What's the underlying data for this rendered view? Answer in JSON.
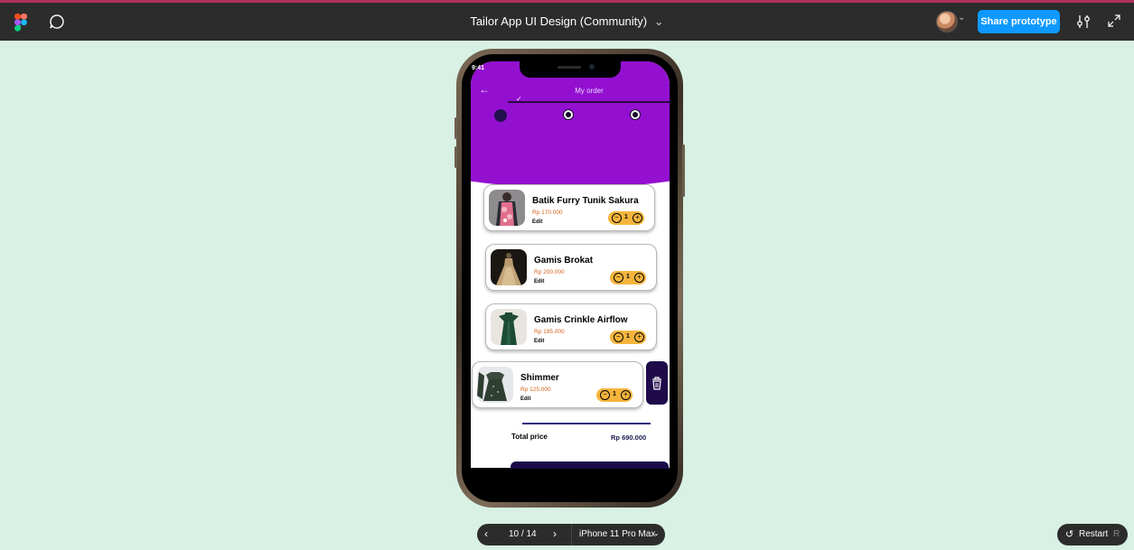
{
  "toolbar": {
    "title": "Tailor App UI Design (Community)",
    "title_caret": "⌄",
    "share_label": "Share prototype",
    "avatar_caret": "⌄",
    "icons": [
      "figma-logo-icon",
      "comment-icon",
      "settings-sliders-icon",
      "expand-icon"
    ]
  },
  "colors": {
    "toolbar_bg": "#2c2c2c",
    "share_btn": "#0d99ff",
    "canvas_bg": "#d8f1e4",
    "app_purple": "#9310d1",
    "qty_bg": "#f5b53c",
    "price_text": "#d5601a",
    "dark_navy": "#1f0a4a"
  },
  "app": {
    "status_time": "9:41",
    "back_icon": "←",
    "header_title": "My order",
    "step_check": "✓",
    "items": [
      {
        "name": "Batik Furry Tunik Sakura",
        "price": "Rp 170.000",
        "edit": "Edit",
        "qty": "1"
      },
      {
        "name": "Gamis Brokat",
        "price": "Rp 200.000",
        "edit": "Edit",
        "qty": "1"
      },
      {
        "name": "Gamis Crinkle Airflow",
        "price": "Rp 195.000",
        "edit": "Edit",
        "qty": "1"
      },
      {
        "name": "Shimmer",
        "price": "Rp 125.000",
        "edit": "Edit",
        "qty": "1"
      }
    ],
    "minus_icon": "−",
    "plus_icon": "+",
    "total_label": "Total price",
    "total_value": "Rp 690.000"
  },
  "pager": {
    "prev": "‹",
    "count": "10 / 14",
    "next": "›",
    "device": "iPhone 11 Pro Max",
    "device_caret": "⌄"
  },
  "restart": {
    "icon": "↺",
    "label": "Restart",
    "shortcut": "R"
  }
}
